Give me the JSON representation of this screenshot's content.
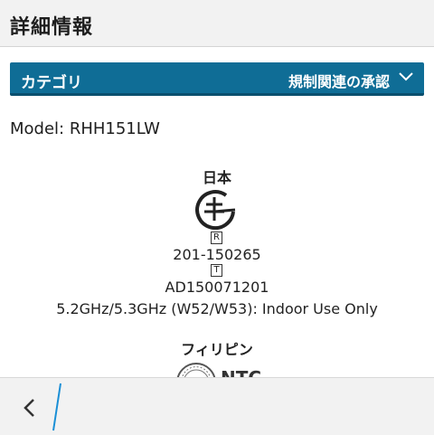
{
  "header": {
    "title": "詳細情報"
  },
  "category": {
    "label": "カテゴリ",
    "selected": "規制関連の承認"
  },
  "content": {
    "model": "Model: RHH151LW",
    "japan": {
      "country": "日本",
      "r_mark": "R",
      "r_cert": "201-150265",
      "t_mark": "T",
      "t_cert": "AD150071201",
      "frequency": "5.2GHz/5.3GHz (W52/W53): Indoor Use Only"
    },
    "philippines": {
      "country": "フィリピン"
    }
  },
  "colors": {
    "accent": "#0f6d96",
    "divider": "#1a8fd6"
  },
  "icons": {
    "category": "chevron-down-icon",
    "back": "back-arrow-icon"
  }
}
